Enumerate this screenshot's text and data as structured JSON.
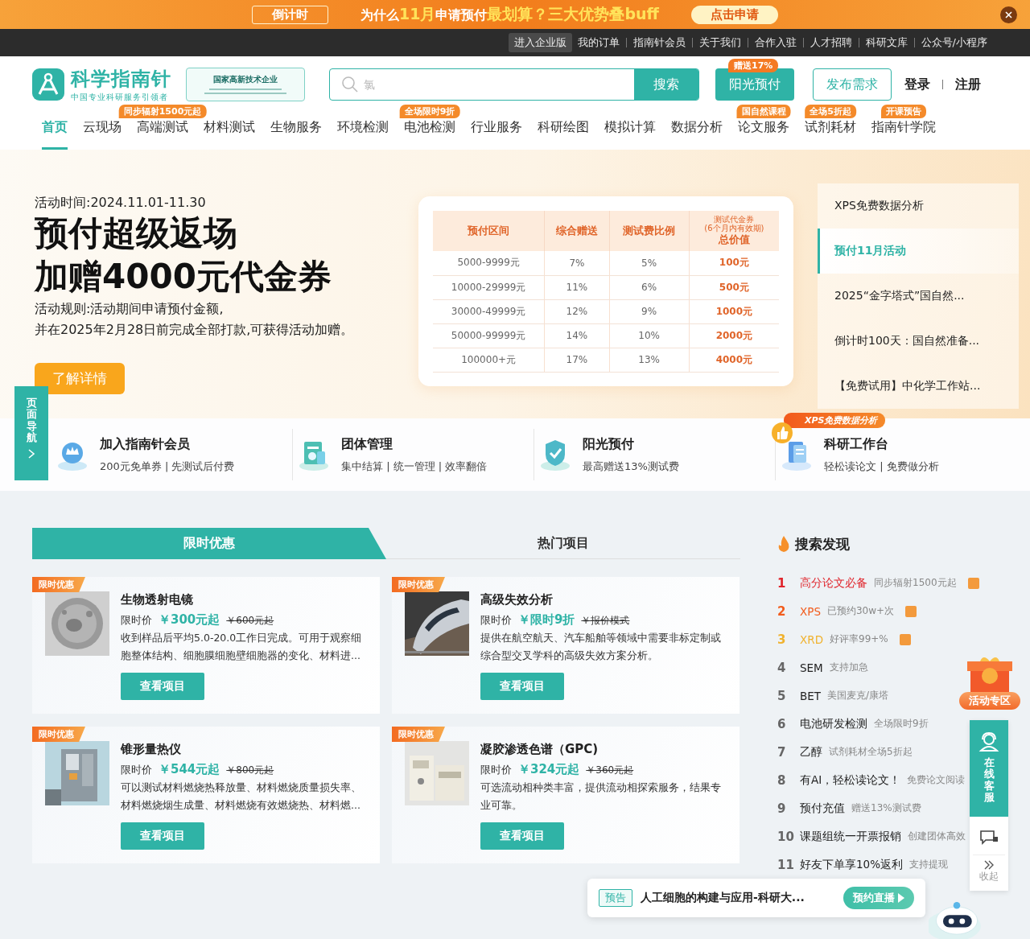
{
  "promo_banner": {
    "countdown": "倒计时",
    "headline": [
      {
        "text": "为什么",
        "kind": "plain"
      },
      {
        "text": "11月",
        "kind": "accent"
      },
      {
        "text": "申请预付",
        "kind": "plain"
      },
      {
        "text": "最划算？三大优势叠buff",
        "kind": "accent"
      }
    ],
    "cta": "点击申请"
  },
  "top_links": [
    {
      "label": "进入企业版",
      "highlighted": true
    },
    {
      "label": "我的订单",
      "highlighted": false
    },
    {
      "label": "指南针会员",
      "highlighted": false
    },
    {
      "label": "关于我们",
      "highlighted": false
    },
    {
      "label": "合作入驻",
      "highlighted": false
    },
    {
      "label": "人才招聘",
      "highlighted": false
    },
    {
      "label": "科研文库",
      "highlighted": false
    },
    {
      "label": "公众号/小程序",
      "highlighted": false
    }
  ],
  "header": {
    "logo_name": "科学指南针",
    "logo_tagline": "中国专业科研服务引领者",
    "certificate": "国家高新技术企业",
    "search": {
      "placeholder": "氯",
      "button": "搜索"
    },
    "prepay": {
      "label": "阳光预付",
      "badge": "赠送17%"
    },
    "publish": "发布需求",
    "login": "登录",
    "register": "注册"
  },
  "nav": [
    {
      "label": "首页",
      "selected": true
    },
    {
      "label": "云现场",
      "selected": false
    },
    {
      "label": "高端测试",
      "selected": false,
      "badge": "同步辐射1500元起"
    },
    {
      "label": "材料测试",
      "selected": false
    },
    {
      "label": "生物服务",
      "selected": false
    },
    {
      "label": "环境检测",
      "selected": false
    },
    {
      "label": "电池检测",
      "selected": false,
      "badge": "全场限时9折"
    },
    {
      "label": "行业服务",
      "selected": false
    },
    {
      "label": "科研绘图",
      "selected": false
    },
    {
      "label": "模拟计算",
      "selected": false
    },
    {
      "label": "数据分析",
      "selected": false
    },
    {
      "label": "论文服务",
      "selected": false,
      "badge": "国自然课程"
    },
    {
      "label": "试剂耗材",
      "selected": false,
      "badge": "全场5折起"
    },
    {
      "label": "指南针学院",
      "selected": false,
      "badge": "开课预告"
    }
  ],
  "hero": {
    "period": "活动时间:2024.11.01-11.30",
    "title_lines": [
      "预付超级返场",
      "加赠4000元代金券"
    ],
    "rules": [
      "活动规则:活动期间申请预付金额,",
      "并在2025年2月28日前完成全部打款,可获得活动加赠。"
    ],
    "button": "了解详情",
    "table": {
      "columns": [
        {
          "label": "预付区间"
        },
        {
          "label": "综合赠送"
        },
        {
          "label": "测试费比例"
        },
        {
          "notes": [
            "测试代金券",
            "(6个月内有效期)"
          ],
          "label": "总价值"
        }
      ],
      "rows": [
        [
          "5000-9999元",
          "7%",
          "5%",
          "100元"
        ],
        [
          "10000-29999元",
          "11%",
          "6%",
          "500元"
        ],
        [
          "30000-49999元",
          "12%",
          "9%",
          "1000元"
        ],
        [
          "50000-99999元",
          "14%",
          "10%",
          "2000元"
        ],
        [
          "100000+元",
          "17%",
          "13%",
          "4000元"
        ]
      ]
    },
    "side_menu": [
      {
        "label": "XPS免费数据分析",
        "selected": false
      },
      {
        "label": "预付11月活动",
        "selected": true
      },
      {
        "label": "2025“金字塔式”国自然...",
        "selected": false
      },
      {
        "label": "倒计时100天：国自然准备...",
        "selected": false
      },
      {
        "label": "【免费试用】中化学工作站...",
        "selected": false
      }
    ]
  },
  "features": [
    {
      "title": "加入指南针会员",
      "subtitle": "200元免单券 | 先测试后付费"
    },
    {
      "title": "团体管理",
      "subtitle": "集中结算 | 统一管理 | 效率翻倍"
    },
    {
      "title": "阳光预付",
      "subtitle": "最高赠送13%测试费"
    },
    {
      "title": "科研工作台",
      "subtitle": "轻松读论文 | 免费做分析",
      "badge": "XPS免费数据分析"
    }
  ],
  "deals": {
    "tabs": [
      {
        "label": "限时优惠",
        "selected": true
      },
      {
        "label": "热门项目",
        "selected": false
      }
    ],
    "cards": [
      {
        "tag": "限时优惠",
        "title": "生物透射电镜",
        "price_label": "限时价",
        "price": "￥300元起",
        "original_price": "￥600元起",
        "description": "收到样品后平均5.0-20.0工作日完成。可用于观察细胞整体结构、细胞膜细胞壁细胞器的变化、材料进...",
        "button": "查看项目"
      },
      {
        "tag": "限时优惠",
        "title": "高级失效分析",
        "price_label": "限时价",
        "price": "￥限时9折",
        "original_price": "￥报价模式",
        "description": "提供在航空航天、汽车船舶等领域中需要非标定制或综合型交叉学科的高级失效方案分析。",
        "button": "查看项目"
      },
      {
        "tag": "限时优惠",
        "title": "锥形量热仪",
        "price_label": "限时价",
        "price": "￥544元起",
        "original_price": "￥800元起",
        "description": "可以测试材料燃烧热释放量、材料燃烧质量损失率、材料燃烧烟生成量、材料燃烧有效燃烧热、材料燃...",
        "button": "查看项目"
      },
      {
        "tag": "限时优惠",
        "title": "凝胶渗透色谱（GPC)",
        "price_label": "限时价",
        "price": "￥324元起",
        "original_price": "￥360元起",
        "description": "可选流动相种类丰富，提供流动相探索服务，结果专业可靠。",
        "button": "查看项目"
      }
    ]
  },
  "search_discovery": {
    "title": "搜索发现",
    "items": [
      {
        "rank": "1",
        "term": "高分论文必备",
        "note": "同步辐射1500元起",
        "hot": true,
        "color": "#e0242b"
      },
      {
        "rank": "2",
        "term": "XPS",
        "note": "已预约30w+次",
        "hot": true,
        "color": "#f25c1c"
      },
      {
        "rank": "3",
        "term": "XRD",
        "note": "好评率99+%",
        "hot": true,
        "color": "#f0b22e"
      },
      {
        "rank": "4",
        "term": "SEM",
        "note": "支持加急",
        "hot": false,
        "color": "#666666"
      },
      {
        "rank": "5",
        "term": "BET",
        "note": "美国麦克/康塔",
        "hot": false,
        "color": "#666666"
      },
      {
        "rank": "6",
        "term": "电池研发检测",
        "note": "全场限时9折",
        "hot": false,
        "color": "#666666"
      },
      {
        "rank": "7",
        "term": "乙醇",
        "note": "试剂耗材全场5折起",
        "hot": false,
        "color": "#666666"
      },
      {
        "rank": "8",
        "term": "有AI，轻松读论文！",
        "note": "免费论文阅读",
        "hot": false,
        "color": "#666666"
      },
      {
        "rank": "9",
        "term": "预付充值",
        "note": "赠送13%测试费",
        "hot": false,
        "color": "#666666"
      },
      {
        "rank": "10",
        "term": "课题组统一开票报销",
        "note": "创建团体高效",
        "hot": false,
        "color": "#666666"
      },
      {
        "rank": "11",
        "term": "好友下单享10%返利",
        "note": "支持提现",
        "hot": false,
        "color": "#666666"
      }
    ]
  },
  "floating": {
    "page_nav": "页面导航",
    "activity": "活动专区",
    "service": "在线客服",
    "collapse": "收起",
    "live": {
      "tag": "预告",
      "title": "人工细胞的构建与应用-科研大...",
      "button": "预约直播"
    }
  }
}
